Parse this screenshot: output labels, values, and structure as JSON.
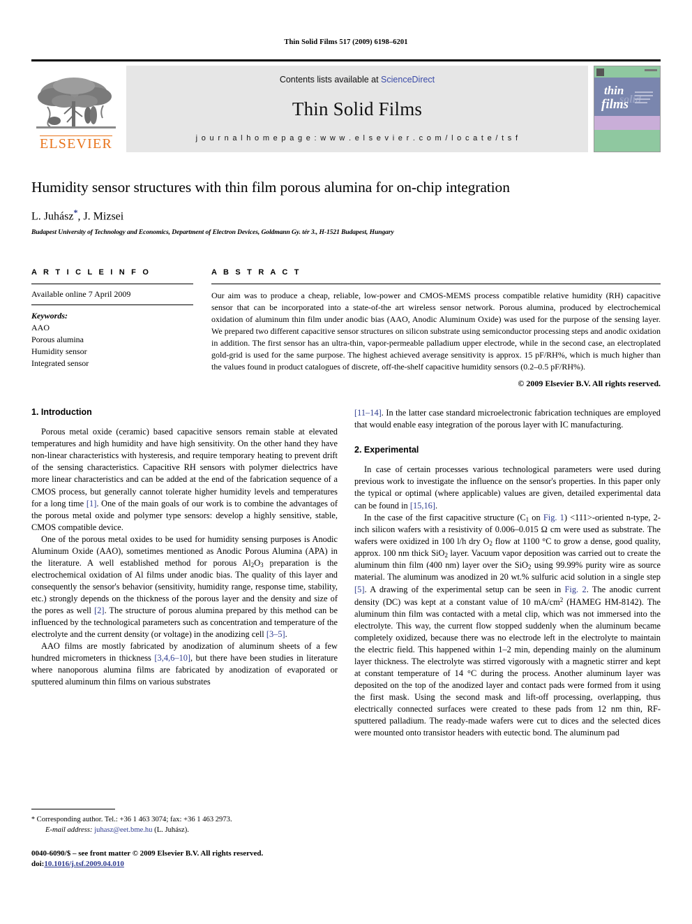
{
  "running_head": "Thin Solid Films 517 (2009) 6198–6201",
  "masthead": {
    "publisher_name": "ELSEVIER",
    "contents_prefix": "Contents lists available at ",
    "contents_link": "ScienceDirect",
    "journal_name": "Thin Solid Films",
    "homepage": "j o u r n a l   h o m e p a g e :   w w w . e l s e v i e r . c o m / l o c a t e / t s f",
    "cover_title_line1": "thin",
    "cover_title_line2": "solid",
    "cover_title_line3": "films"
  },
  "title_block": {
    "title": "Humidity sensor structures with thin film porous alumina for on-chip integration",
    "authors_pre": "L. Juhász",
    "author_star": "*",
    "authors_post": ", J. Mizsei",
    "affiliation": "Budapest University of Technology and Economics, Department of Electron Devices, Goldmann Gy. tér 3., H-1521 Budapest, Hungary"
  },
  "article_info": {
    "heading": "A R T I C L E   I N F O",
    "available_online": "Available online 7 April 2009",
    "keywords_label": "Keywords:",
    "keywords": [
      "AAO",
      "Porous alumina",
      "Humidity sensor",
      "Integrated sensor"
    ]
  },
  "abstract": {
    "heading": "A B S T R A C T",
    "text": "Our aim was to produce a cheap, reliable, low-power and CMOS-MEMS process compatible relative humidity (RH) capacitive sensor that can be incorporated into a state-of-the art wireless sensor network. Porous alumina, produced by electrochemical oxidation of aluminum thin film under anodic bias (AAO, Anodic Aluminum Oxide) was used for the purpose of the sensing layer. We prepared two different capacitive sensor structures on silicon substrate using semiconductor processing steps and anodic oxidation in addition. The first sensor has an ultra-thin, vapor-permeable palladium upper electrode, while in the second case, an electroplated gold-grid is used for the same purpose. The highest achieved average sensitivity is approx. 15 pF/RH%, which is much higher than the values found in product catalogues of discrete, off-the-shelf capacitive humidity sensors (0.2–0.5 pF/RH%).",
    "copyright": "© 2009 Elsevier B.V. All rights reserved."
  },
  "sections": {
    "introduction_heading": "1. Introduction",
    "experimental_heading": "2. Experimental",
    "intro_p1_a": "Porous metal oxide (ceramic) based capacitive sensors remain stable at elevated temperatures and high humidity and have high sensitivity. On the other hand they have non-linear characteristics with hysteresis, and require temporary heating to prevent drift of the sensing characteristics. Capacitive RH sensors with polymer dielectrics have more linear characteristics and can be added at the end of the fabrication sequence of a CMOS process, but generally cannot tolerate higher humidity levels and temperatures for a long time ",
    "intro_p1_ref": "[1]",
    "intro_p1_b": ". One of the main goals of our work is to combine the advantages of the porous metal oxide and polymer type sensors: develop a highly sensitive, stable, CMOS compatible device.",
    "intro_p2_a": "One of the porous metal oxides to be used for humidity sensing purposes is Anodic Aluminum Oxide (AAO), sometimes mentioned as Anodic Porous Alumina (APA) in the literature. A well established method for porous Al",
    "intro_p2_sub1": "2",
    "intro_p2_mid1": "O",
    "intro_p2_sub2": "3",
    "intro_p2_b": " preparation is the electrochemical oxidation of Al films under anodic bias. The quality of this layer and consequently the sensor's behavior (sensitivity, humidity range, response time, stability, etc.) strongly depends on the thickness of the porous layer and the density and size of the pores as well ",
    "intro_p2_ref1": "[2]",
    "intro_p2_c": ". The structure of porous alumina prepared by this method can be influenced by the technological parameters such as concentration and temperature of the electrolyte and the current density (or voltage) in the anodizing cell ",
    "intro_p2_ref2": "[3–5]",
    "intro_p2_d": ".",
    "intro_p3_a": "AAO films are mostly fabricated by anodization of aluminum sheets of a few hundred micrometers in thickness ",
    "intro_p3_ref1": "[3,4,6–10]",
    "intro_p3_b": ", but there have been studies in literature where nanoporous alumina films are fabricated by anodization of evaporated or sputtered aluminum thin films on various substrates ",
    "intro_p3_ref2": "[11–14]",
    "intro_p3_c": ". In the latter case standard microelectronic fabrication techniques are employed that would enable easy integration of the porous layer with IC manufacturing.",
    "exp_p1_a": "In case of certain processes various technological parameters were used during previous work to investigate the influence on the sensor's properties. In this paper only the typical or optimal (where applicable) values are given, detailed experimental data can be found in ",
    "exp_p1_ref": "[15,16]",
    "exp_p1_b": ".",
    "exp_p2_a": "In the case of the first capacitive structure (C",
    "exp_p2_sub1": "1",
    "exp_p2_b": " on ",
    "exp_p2_figref1": "Fig. 1",
    "exp_p2_c": ") <111>-oriented n-type, 2-inch silicon wafers with a resistivity of 0.006–0.015 Ω cm were used as substrate. The wafers were oxidized in 100 l/h dry O",
    "exp_p2_sub2": "2",
    "exp_p2_d": " flow at 1100 °C to grow a dense, good quality, approx. 100 nm thick SiO",
    "exp_p2_sub3": "2",
    "exp_p2_e": " layer. Vacuum vapor deposition was carried out to create the aluminum thin film (400 nm) layer over the SiO",
    "exp_p2_sub4": "2",
    "exp_p2_f": " using 99.99% purity wire as source material. The aluminum was anodized in 20 wt.% sulfuric acid solution in a single step ",
    "exp_p2_ref1": "[5]",
    "exp_p2_g": ". A drawing of the experimental setup can be seen in ",
    "exp_p2_figref2": "Fig. 2",
    "exp_p2_h": ". The anodic current density (DC) was kept at a constant value of 10 mA/cm",
    "exp_p2_sup1": "2",
    "exp_p2_i": " (HAMEG HM-8142). The aluminum thin film was contacted with a metal clip, which was not immersed into the electrolyte. This way, the current flow stopped suddenly when the aluminum became completely oxidized, because there was no electrode left in the electrolyte to maintain the electric field. This happened within 1–2 min, depending mainly on the aluminum layer thickness. The electrolyte was stirred vigorously with a magnetic stirrer and kept at constant temperature of 14 °C during the process. Another aluminum layer was deposited on the top of the anodized layer and contact pads were formed from it using the first mask. Using the second mask and lift-off processing, overlapping, thus electrically connected surfaces were created to these pads from 12 nm thin, RF-sputtered palladium. The ready-made wafers were cut to dices and the selected dices were mounted onto transistor headers with eutectic bond. The aluminum pad"
  },
  "footnotes": {
    "corresponding_star": "*",
    "corresponding_text": " Corresponding author. Tel.: +36 1 463 3074; fax: +36 1 463 2973.",
    "email_label": "E-mail address:",
    "email": "juhasz@eet.bme.hu",
    "email_suffix": " (L. Juhász).",
    "issn_line": "0040-6090/$ – see front matter © 2009 Elsevier B.V. All rights reserved.",
    "doi_label": "doi:",
    "doi_value": "10.1016/j.tsf.2009.04.010"
  },
  "colors": {
    "link": "#2f3c8f",
    "elsevier_orange": "#E8731A",
    "band_gray": "#e6e6e6"
  }
}
